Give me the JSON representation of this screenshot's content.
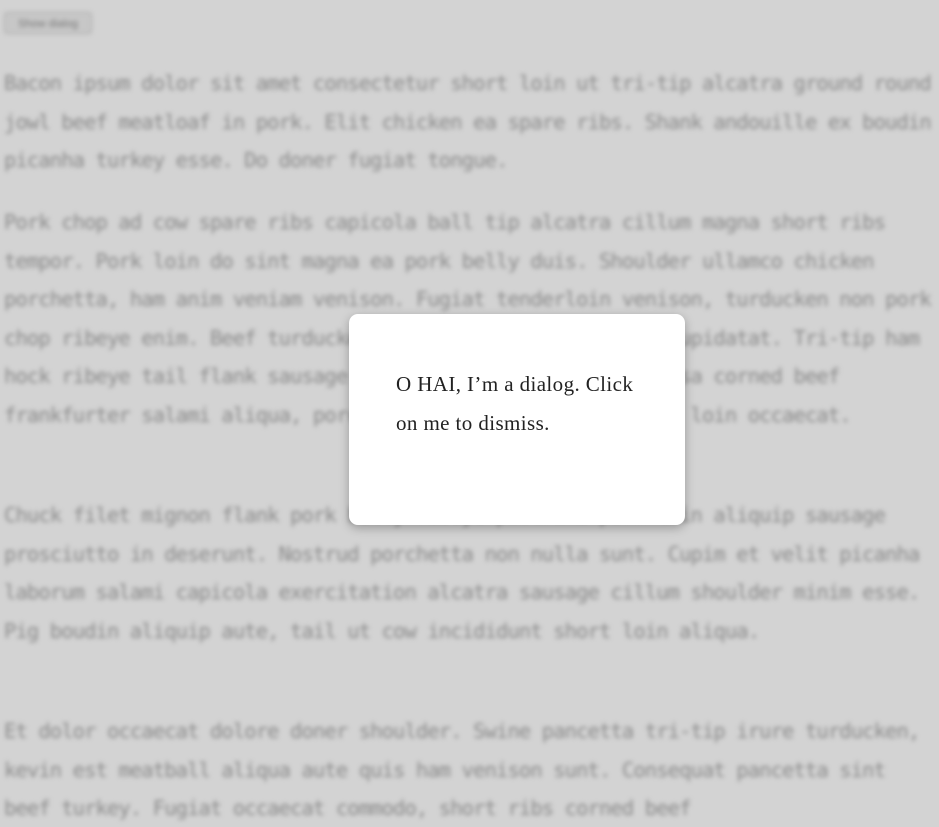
{
  "show_button": {
    "label": "Show dialog"
  },
  "paragraphs": [
    "Bacon ipsum dolor sit amet consectetur short loin ut tri-tip alcatra ground round jowl beef meatloaf in pork. Elit chicken ea spare ribs. Shank andouille ex boudin picanha turkey esse. Do doner fugiat tongue.",
    "Pork chop ad cow spare ribs capicola ball tip alcatra cillum magna short ribs tempor. Pork loin do sint magna ea pork belly duis. Shoulder ullamco chicken porchetta, ham anim veniam venison. Fugiat tenderloin venison, turducken non pork chop ribeye enim. Beef turducken cupim fatback ut commodo cupidatat. Tri-tip ham hock ribeye tail flank sausage ball tip nulla turkey kielbasa corned beef frankfurter salami aliqua, porchetta cupidatat sirloin pork loin occaecat.",
    "Chuck filet mignon flank pork belly ribeye pastrami pork loin aliquip sausage prosciutto in deserunt. Nostrud porchetta non nulla sunt. Cupim et velit picanha laborum salami capicola exercitation alcatra sausage cillum shoulder minim esse. Pig boudin aliquip aute, tail ut cow incididunt short loin aliqua.",
    "Et dolor occaecat dolore doner shoulder. Swine pancetta tri-tip irure turducken, kevin est meatball aliqua aute quis ham venison sunt. Consequat pancetta sint beef turkey. Fugiat occaecat commodo, short ribs corned beef"
  ],
  "dialog": {
    "text": "O HAI, I’m a dialog. Click on me to dismiss."
  }
}
